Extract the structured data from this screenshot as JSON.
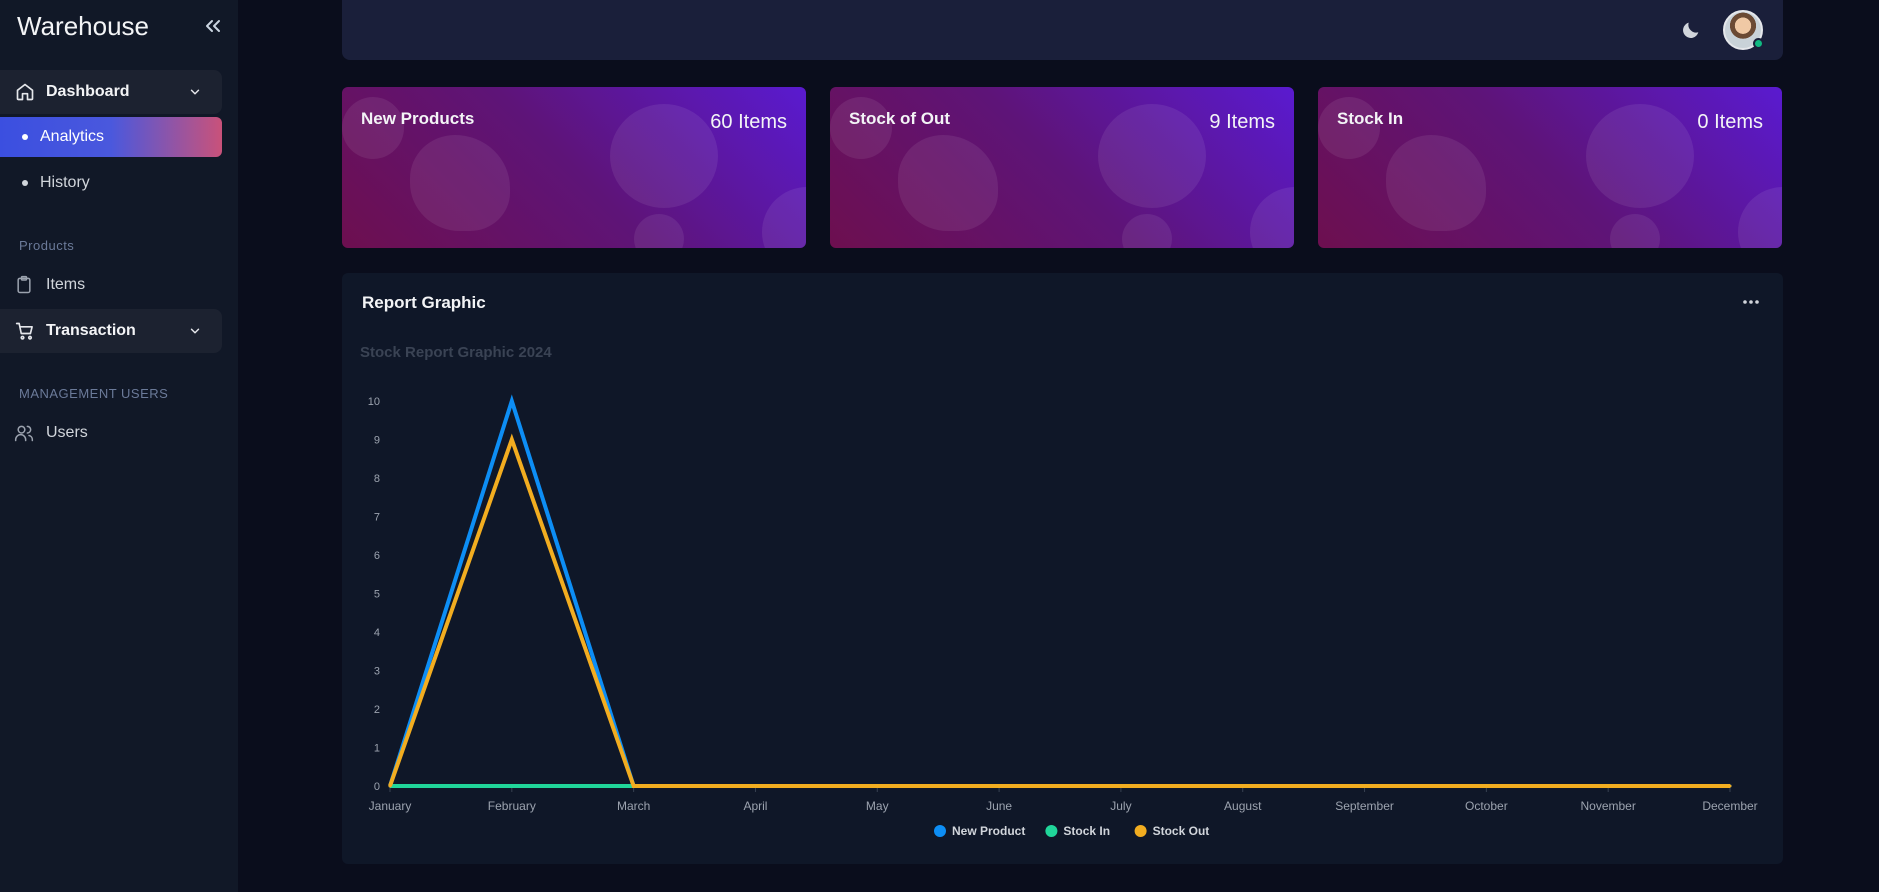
{
  "sidebar": {
    "brand": "Warehouse",
    "dashboard": {
      "label": "Dashboard",
      "items": [
        {
          "label": "Analytics",
          "active": true
        },
        {
          "label": "History",
          "active": false
        }
      ]
    },
    "products_section": "Products",
    "items_label": "Items",
    "transaction_label": "Transaction",
    "management_section": "MANAGEMENT USERS",
    "users_label": "Users"
  },
  "cards": [
    {
      "title": "New Products",
      "value": "60 Items"
    },
    {
      "title": "Stock of Out",
      "value": "9 Items"
    },
    {
      "title": "Stock In",
      "value": "0 Items"
    }
  ],
  "report": {
    "title": "Report Graphic"
  },
  "chart_data": {
    "type": "line",
    "title": "Stock Report Graphic 2024",
    "x": [
      "January",
      "February",
      "March",
      "April",
      "May",
      "June",
      "July",
      "August",
      "September",
      "October",
      "November",
      "December"
    ],
    "ylim": [
      0,
      10
    ],
    "yticks": [
      "0",
      "1",
      "2",
      "3",
      "4",
      "5",
      "6",
      "7",
      "8",
      "9",
      "10"
    ],
    "series": [
      {
        "name": "New Product",
        "color": "#0d8ef5",
        "values": [
          0,
          10,
          0,
          0,
          0,
          0,
          0,
          0,
          0,
          0,
          0,
          0
        ]
      },
      {
        "name": "Stock In",
        "color": "#20d69a",
        "values": [
          0,
          0,
          0,
          0,
          0,
          0,
          0,
          0,
          0,
          0,
          0,
          0
        ]
      },
      {
        "name": "Stock Out",
        "color": "#f2ad20",
        "values": [
          0,
          9,
          0,
          0,
          0,
          0,
          0,
          0,
          0,
          0,
          0,
          0
        ]
      }
    ],
    "legend": "bottom-center",
    "grid": false
  }
}
